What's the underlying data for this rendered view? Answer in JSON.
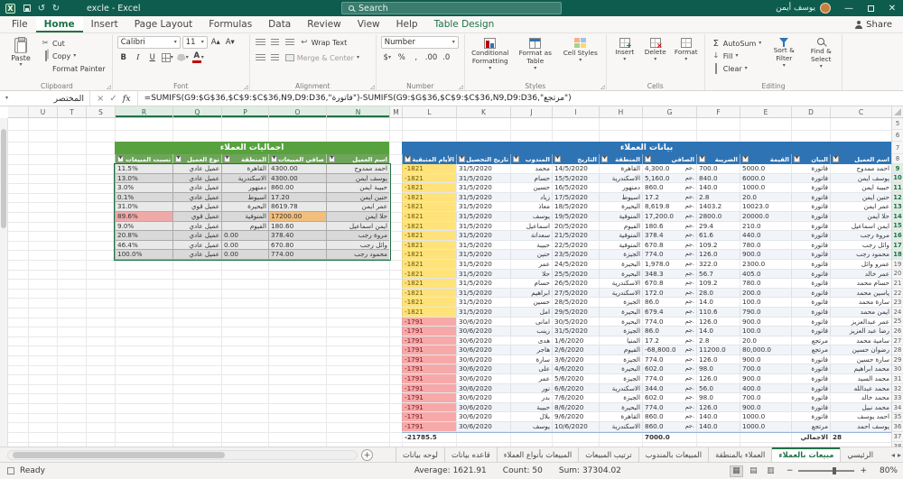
{
  "title_bar": {
    "app_title": "excle - Excel",
    "search": "Search",
    "user_name": "يوسف أيمن"
  },
  "ribbon_tabs": [
    {
      "label": "File"
    },
    {
      "label": "Home",
      "active": true
    },
    {
      "label": "Insert"
    },
    {
      "label": "Page Layout"
    },
    {
      "label": "Formulas"
    },
    {
      "label": "Data"
    },
    {
      "label": "Review"
    },
    {
      "label": "View"
    },
    {
      "label": "Help"
    },
    {
      "label": "Table Design",
      "contextual": true
    }
  ],
  "share_label": "Share",
  "ribbon": {
    "clipboard": {
      "label": "Clipboard",
      "paste": "Paste",
      "cut": "Cut",
      "copy": "Copy",
      "format_painter": "Format Painter"
    },
    "font": {
      "label": "Font",
      "font_name": "Calibri",
      "font_size": "11",
      "bold": "B",
      "italic": "I",
      "underline": "U",
      "grow": "A▴",
      "shrink": "A▾"
    },
    "alignment": {
      "label": "Alignment",
      "wrap_text": "Wrap Text",
      "merge_center": "Merge & Center"
    },
    "number": {
      "label": "Number",
      "format": "Number",
      "currency": "$",
      "percent": "%",
      "comma": ",",
      "dec_inc": ".00",
      "dec_dec": ".0"
    },
    "styles": {
      "label": "Styles",
      "conditional": "Conditional Formatting",
      "format_table": "Format as Table",
      "cell_styles": "Cell Styles"
    },
    "cells": {
      "label": "Cells",
      "insert": "Insert",
      "delete": "Delete",
      "format": "Format"
    },
    "editing": {
      "label": "Editing",
      "autosum": "AutoSum",
      "fill": "Fill",
      "clear": "Clear",
      "sort_filter": "Sort & Filter",
      "find_select": "Find & Select"
    }
  },
  "formula_bar": {
    "name_box": "المختصر",
    "fx": "fx",
    "formula": "=SUMIFS(G9:$G$36,$C$9:$C$36,N9,D9:D36,\"فاتورة\")-SUMIFS(G9:$G$36,$C$9:$C$36,N9,D9:D36,\"مرتجع\")"
  },
  "grid": {
    "column_letters": [
      "U",
      "T",
      "S",
      "R",
      "Q",
      "P",
      "O",
      "N",
      "M",
      "L",
      "K",
      "J",
      "I",
      "H",
      "G",
      "F",
      "E",
      "D",
      "C"
    ],
    "row_numbers": [
      "5",
      "6",
      "7",
      "8",
      "9",
      "10",
      "11",
      "12",
      "13",
      "14",
      "15",
      "16",
      "17",
      "18",
      "19",
      "20",
      "21",
      "22",
      "23",
      "24",
      "25",
      "26",
      "27",
      "28",
      "29",
      "30",
      "31",
      "32",
      "33",
      "34",
      "35",
      "36",
      "37",
      "38",
      "39"
    ],
    "selected_columns": [
      "R",
      "Q",
      "P",
      "O",
      "N"
    ],
    "selected_rows": [
      "9",
      "10",
      "11",
      "12",
      "13",
      "14",
      "15",
      "16",
      "17",
      "18"
    ]
  },
  "left_table": {
    "title": "اجماليات العملاء",
    "columns": [
      "اسم العميل",
      "صافي المبيعات",
      "المنطقة",
      "نوع العميل",
      "نسبت المبيعات"
    ],
    "rows": [
      [
        "احمد ممدوح",
        "4300.00",
        "القاهرة",
        "عميل عادي",
        "11.5%"
      ],
      [
        "يوسف ايمن",
        "4300.00",
        "الاسكندرية",
        "عميل عادي",
        "13.0%"
      ],
      [
        "حبيبة ايمن",
        "860.00",
        "دمنهور",
        "عميل عادي",
        "3.0%"
      ],
      [
        "حنين ايمن",
        "17.20",
        "اسيوط",
        "عميل عادي",
        "0.1%"
      ],
      [
        "عمر ايمن",
        "8619.78",
        "البحيرة",
        "عميل قوي",
        "31.0%"
      ],
      [
        "حلا ايمن",
        "17200.00",
        "المنوفية",
        "عميل قوي",
        "89.6%"
      ],
      [
        "ايمن اسماعيل",
        "180.60",
        "الفيوم",
        "عميل عادي",
        "9.0%"
      ],
      [
        "مروة رجب",
        "378.40",
        "0.00",
        "عميل عادي",
        "20.8%"
      ],
      [
        "وائل رجب",
        "670.80",
        "0.00",
        "عميل عادي",
        "46.4%"
      ],
      [
        "محمود رجب",
        "774.00",
        "0.00",
        "عميل عادي",
        "100.0%"
      ]
    ],
    "highlight": {
      "row_index": 5,
      "net_color": "#F2BE7C",
      "pct_color": "#EFA9A9"
    }
  },
  "right_table": {
    "title": "بيانات العملاء",
    "columns": [
      "اسم العميل",
      "البيان",
      "القيمة",
      "الضريبة",
      "الصافي",
      "المنطقة",
      "التاريخ",
      "المندوب",
      "تاريخ التحصيل",
      "الأيام المتبقية"
    ],
    "rows": [
      [
        "احمد ممدوح",
        "فاتورة",
        "5000.0",
        "700.0",
        "جم. 4,300.0",
        "القاهرة",
        "14/5/2020",
        "محمد",
        "31/5/2020",
        "-1821"
      ],
      [
        "يوسف ايمن",
        "فاتورة",
        "6000.0",
        "840.0",
        "جم. 5,160.0",
        "الاسكندرية",
        "15/5/2020",
        "حسام",
        "31/5/2020",
        "-1821"
      ],
      [
        "حبيبة ايمن",
        "فاتورة",
        "1000.0",
        "140.0",
        "جم. 860.0",
        "دمنهور",
        "16/5/2020",
        "حسين",
        "31/5/2020",
        "-1821"
      ],
      [
        "حنين ايمن",
        "فاتورة",
        "20.0",
        "2.8",
        "جم. 17.2",
        "اسيوط",
        "17/5/2020",
        "زياد",
        "31/5/2020",
        "-1821"
      ],
      [
        "عمر ايمن",
        "فاتورة",
        "10023.0",
        "1403.2",
        "جم. 8,619.8",
        "البحيرة",
        "18/5/2020",
        "معاذ",
        "31/5/2020",
        "-1821"
      ],
      [
        "حلا ايمن",
        "فاتورة",
        "20000.0",
        "2800.0",
        "جم. 17,200.0",
        "المنوفية",
        "19/5/2020",
        "يوسف",
        "31/5/2020",
        "-1821"
      ],
      [
        "ايمن اسماعيل",
        "فاتورة",
        "210.0",
        "29.4",
        "جم. 180.6",
        "الفيوم",
        "20/5/2020",
        "اسماعيل",
        "31/5/2020",
        "-1821"
      ],
      [
        "مروة رجب",
        "فاتورة",
        "440.0",
        "61.6",
        "جم. 378.4",
        "المنوفية",
        "21/5/2020",
        "سعدانة",
        "31/5/2020",
        "-1821"
      ],
      [
        "وائل رجب",
        "فاتورة",
        "780.0",
        "109.2",
        "جم. 670.8",
        "المنوفية",
        "22/5/2020",
        "حبيبة",
        "31/5/2020",
        "-1821"
      ],
      [
        "محمود رجب",
        "فاتورة",
        "900.0",
        "126.0",
        "جم. 774.0",
        "الجيزة",
        "23/5/2020",
        "حنين",
        "31/5/2020",
        "-1821"
      ],
      [
        "عمرو وائل",
        "فاتورة",
        "2300.0",
        "322.0",
        "جم. 1,978.0",
        "البحيرة",
        "24/5/2020",
        "عمر",
        "31/5/2020",
        "-1821"
      ],
      [
        "عمر خالد",
        "فاتورة",
        "405.0",
        "56.7",
        "جم. 348.3",
        "البحيرة",
        "25/5/2020",
        "حلا",
        "31/5/2020",
        "-1821"
      ],
      [
        "حسام محمد",
        "فاتورة",
        "780.0",
        "109.2",
        "جم. 670.8",
        "الاسكندرية",
        "26/5/2020",
        "حسام",
        "31/5/2020",
        "-1821"
      ],
      [
        "ياسين محمد",
        "فاتورة",
        "200.0",
        "28.0",
        "جم. 172.0",
        "الاسكندرية",
        "27/5/2020",
        "ابراهيم",
        "31/5/2020",
        "-1821"
      ],
      [
        "سارة محمد",
        "فاتورة",
        "100.0",
        "14.0",
        "جم. 86.0",
        "الجيزة",
        "28/5/2020",
        "حسين",
        "31/5/2020",
        "-1821"
      ],
      [
        "ايمن محمد",
        "فاتورة",
        "790.0",
        "110.6",
        "جم. 679.4",
        "البحيرة",
        "29/5/2020",
        "امل",
        "31/5/2020",
        "-1821"
      ],
      [
        "عمر عبدالعزيز",
        "فاتورة",
        "900.0",
        "126.0",
        "جم. 774.0",
        "البحيرة",
        "30/5/2020",
        "امانى",
        "30/6/2020",
        "-1791"
      ],
      [
        "رضا عبد العزيز",
        "فاتورة",
        "100.0",
        "14.0",
        "جم. 86.0",
        "الجيزة",
        "31/5/2020",
        "زينب",
        "30/6/2020",
        "-1791"
      ],
      [
        "سامية محمد",
        "مرتجع",
        "20.0",
        "2.8",
        "جم. 17.2",
        "المنيا",
        "1/6/2020",
        "هدى",
        "30/6/2020",
        "-1791"
      ],
      [
        "رضوان حسين",
        "مرتجع",
        "80,000.0",
        "11200.0",
        "جم. -68,800.0",
        "الفيوم",
        "2/6/2020",
        "هاجر",
        "30/6/2020",
        "-1791"
      ],
      [
        "سارة حسين",
        "فاتورة",
        "900.0",
        "126.0",
        "جم. 774.0",
        "الجيزة",
        "3/6/2020",
        "سارة",
        "30/6/2020",
        "-1791"
      ],
      [
        "محمد ابراهيم",
        "فاتورة",
        "700.0",
        "98.0",
        "جم. 602.0",
        "البحيرة",
        "4/6/2020",
        "على",
        "30/6/2020",
        "-1791"
      ],
      [
        "محمد السيد",
        "فاتورة",
        "900.0",
        "126.0",
        "جم. 774.0",
        "الجيزة",
        "5/6/2020",
        "عمر",
        "30/6/2020",
        "-1791"
      ],
      [
        "محمد عبدالله",
        "فاتورة",
        "400.0",
        "56.0",
        "جم. 344.0",
        "الاسكندرية",
        "6/6/2020",
        "نور",
        "30/6/2020",
        "-1791"
      ],
      [
        "محمد خالد",
        "فاتورة",
        "700.0",
        "98.0",
        "جم. 602.0",
        "الجيزة",
        "7/6/2020",
        "بدر",
        "30/6/2020",
        "-1791"
      ],
      [
        "محمد نبيل",
        "فاتورة",
        "900.0",
        "126.0",
        "جم. 774.0",
        "البحيرة",
        "8/6/2020",
        "حبيبة",
        "30/6/2020",
        "-1791"
      ],
      [
        "احمد يوسف",
        "فاتورة",
        "1000.0",
        "140.0",
        "جم. 860.0",
        "القاهرة",
        "9/6/2020",
        "بلال",
        "30/6/2020",
        "-1791"
      ],
      [
        "يوسف احمد",
        "مرتجع",
        "1000.0",
        "140.0",
        "جم. 860.0",
        "الاسكندرية",
        "10/6/2020",
        "يوسف",
        "30/6/2020",
        "-1791"
      ]
    ],
    "totals": [
      "28",
      "الاجمالي",
      "",
      "",
      "7000.0",
      "",
      "",
      "",
      "",
      "-21785.5"
    ]
  },
  "sheet_tabs": [
    {
      "label": "الرئيسي"
    },
    {
      "label": "مبيعات بالعملاء",
      "active": true
    },
    {
      "label": "العملاء بالمنطقة"
    },
    {
      "label": "المبيعات بالمندوب"
    },
    {
      "label": "ترتيب المبيعات"
    },
    {
      "label": "المبيعات بأنواع العملاء"
    },
    {
      "label": "قاعده بيانات"
    },
    {
      "label": "لوحه بيانات"
    }
  ],
  "status_bar": {
    "mode": "Ready",
    "average": "Average: 1621.91",
    "count": "Count: 50",
    "sum": "Sum: 37304.02",
    "zoom": "80%"
  },
  "colors": {
    "accent_green": "#217346",
    "table_blue": "#2E74B5",
    "table_green": "#57A23E",
    "overdue_yellow": "#FFE37A",
    "overdue_pink": "#F7A9A9"
  }
}
